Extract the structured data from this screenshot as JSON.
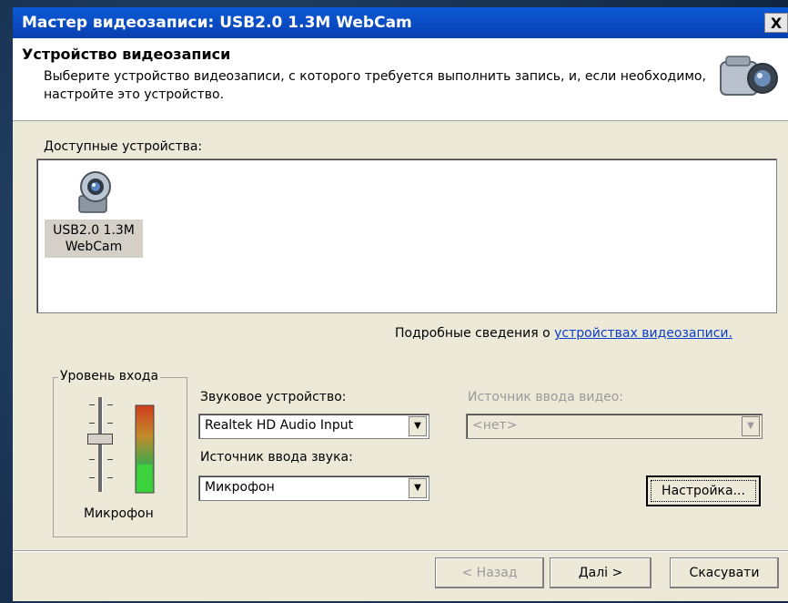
{
  "window": {
    "title": "Мастер видеозаписи: USB2.0 1.3M WebCam",
    "close_glyph": "X"
  },
  "header": {
    "title": "Устройство видеозаписи",
    "description": "Выберите устройство видеозаписи, с которого требуется выполнить запись, и, если необходимо, настройте это устройство."
  },
  "devices": {
    "label": "Доступные устройства:",
    "items": [
      {
        "name": "USB2.0 1.3M WebCam",
        "selected": true
      }
    ]
  },
  "more_info": {
    "prefix": "Подробные сведения о ",
    "link": "устройствах видеозаписи."
  },
  "level": {
    "group_title": "Уровень входа",
    "source_label": "Микрофон",
    "slider_value": 0.5
  },
  "audio": {
    "device_label": "Звуковое устройство:",
    "device_value": "Realtek HD Audio Input",
    "source_label": "Источник ввода звука:",
    "source_value": "Микрофон"
  },
  "video": {
    "source_label": "Источник ввода видео:",
    "source_value": "<нет>"
  },
  "buttons": {
    "settings": "Настройка...",
    "back": "< Назад",
    "next": "Далі >",
    "cancel": "Скасувати"
  },
  "colors": {
    "title_bar": "#0a4fd0",
    "link": "#0a3ec8",
    "meter_green": "#3cd23c",
    "meter_red": "#d23c1e"
  }
}
